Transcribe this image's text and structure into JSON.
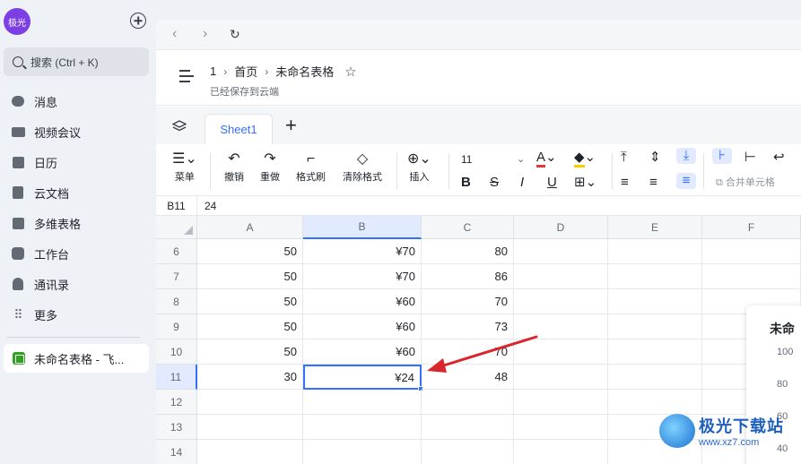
{
  "sidebar": {
    "avatar_text": "极光",
    "search_placeholder": "搜索 (Ctrl + K)",
    "items": [
      {
        "label": "消息",
        "icon": "message-icon"
      },
      {
        "label": "视频会议",
        "icon": "video-icon"
      },
      {
        "label": "日历",
        "icon": "calendar-icon"
      },
      {
        "label": "云文档",
        "icon": "cloud-doc-icon"
      },
      {
        "label": "多维表格",
        "icon": "base-icon"
      },
      {
        "label": "工作台",
        "icon": "workplace-icon"
      },
      {
        "label": "通讯录",
        "icon": "contacts-icon"
      },
      {
        "label": "更多",
        "icon": "more-icon"
      }
    ],
    "open_doc": "未命名表格 - 飞..."
  },
  "titlebar": {
    "crumb_root": "1",
    "crumb_home": "首页",
    "doc_title": "未命名表格",
    "saved_status": "已经保存到云端"
  },
  "tabs": {
    "sheet": "Sheet1",
    "add": "+"
  },
  "toolbar": {
    "menu": "菜单",
    "undo": "撤销",
    "redo": "重做",
    "format_painter": "格式刷",
    "clear_format": "清除格式",
    "insert": "插入",
    "font_size": "11",
    "merge_cells": "合并单元格"
  },
  "formula_bar": {
    "cell_ref": "B11",
    "value": "24"
  },
  "columns": [
    "A",
    "B",
    "C",
    "D",
    "E",
    "F"
  ],
  "rows": [
    {
      "num": "6",
      "a": "50",
      "b": "¥70",
      "c": "80"
    },
    {
      "num": "7",
      "a": "50",
      "b": "¥70",
      "c": "86"
    },
    {
      "num": "8",
      "a": "50",
      "b": "¥60",
      "c": "70"
    },
    {
      "num": "9",
      "a": "50",
      "b": "¥60",
      "c": "73"
    },
    {
      "num": "10",
      "a": "50",
      "b": "¥60",
      "c": "70"
    },
    {
      "num": "11",
      "a": "30",
      "b": "¥24",
      "c": "48"
    },
    {
      "num": "12",
      "a": "",
      "b": "",
      "c": ""
    },
    {
      "num": "13",
      "a": "",
      "b": "",
      "c": ""
    },
    {
      "num": "14",
      "a": "",
      "b": "",
      "c": ""
    }
  ],
  "chart": {
    "title": "未命",
    "ticks": [
      "100",
      "80",
      "60",
      "40"
    ]
  },
  "watermark": {
    "title": "极光下载站",
    "url": "www.xz7.com"
  },
  "colors": {
    "accent": "#3370ff",
    "annotation_arrow": "#d9262c"
  }
}
